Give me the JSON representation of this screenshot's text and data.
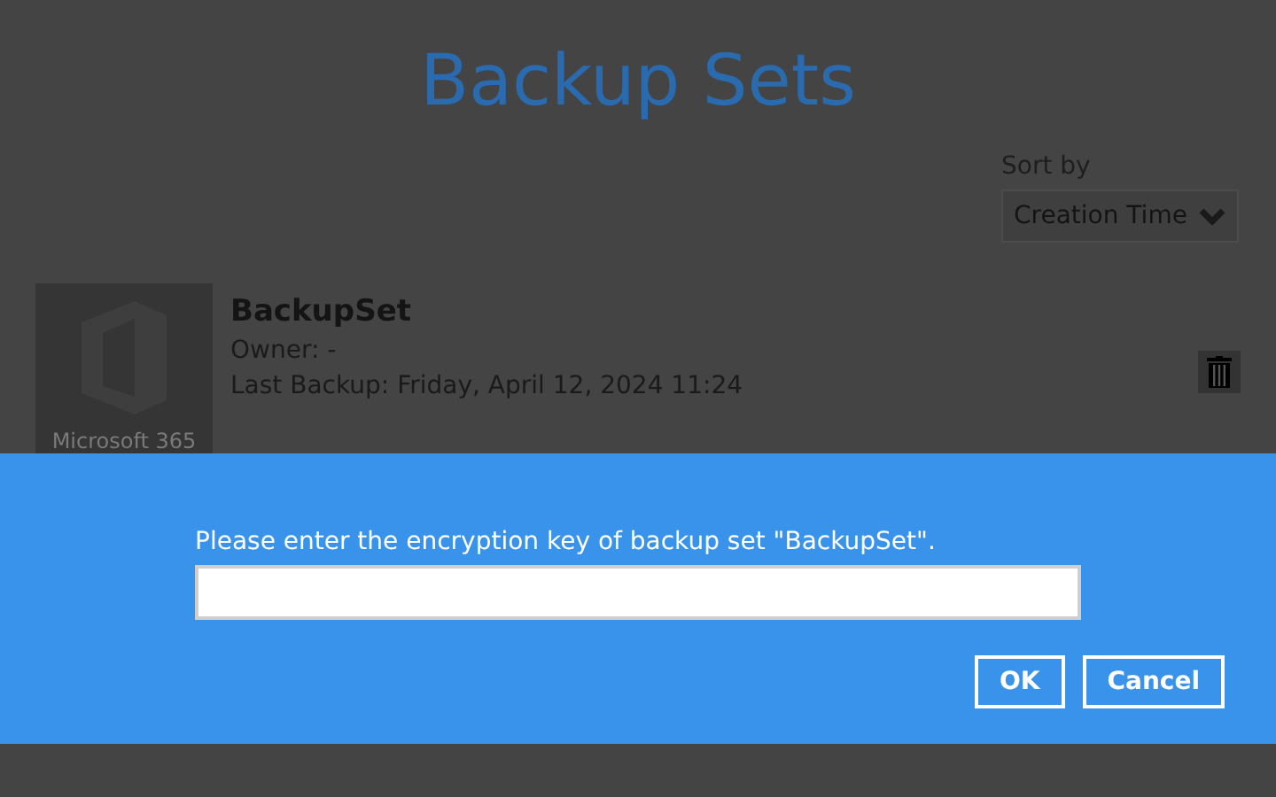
{
  "page": {
    "title": "Backup Sets"
  },
  "sort": {
    "label": "Sort by",
    "value": "Creation Time"
  },
  "backup_sets": [
    {
      "thumbnail_caption": "Microsoft 365",
      "name": "BackupSet",
      "owner": "Owner: -",
      "last_backup": "Last Backup: Friday, April 12, 2024 11:24"
    }
  ],
  "dialog": {
    "message": "Please enter the encryption key of backup set \"BackupSet\".",
    "buttons": [
      "OK",
      "Cancel"
    ]
  }
}
